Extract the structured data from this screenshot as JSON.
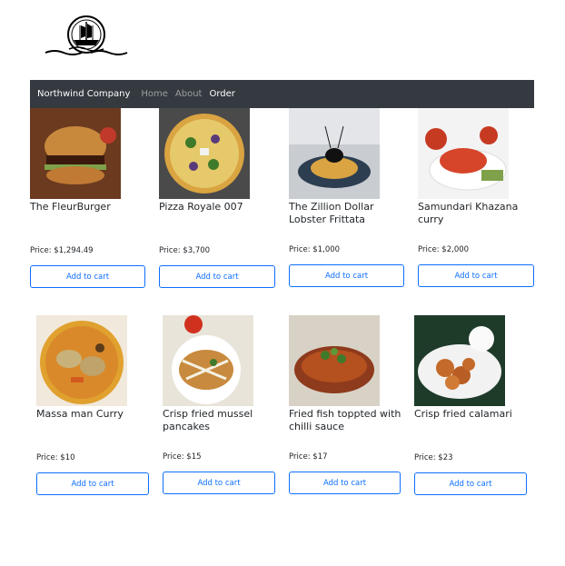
{
  "navbar": {
    "brand": "Northwind Company",
    "links": [
      "Home",
      "About",
      "Order"
    ]
  },
  "products": [
    {
      "name": "The FleurBurger",
      "price": "Price: $1,294.49",
      "button": "Add to cart"
    },
    {
      "name": "Pizza Royale 007",
      "price": "Price: $3,700",
      "button": "Add to cart"
    },
    {
      "name": "The Zillion Dollar Lobster Frittata",
      "price": "Price: $1,000",
      "button": "Add to cart"
    },
    {
      "name": "Samundari Khazana curry",
      "price": "Price: $2,000",
      "button": "Add to cart"
    },
    {
      "name": "Massa man Curry",
      "price": "Price: $10",
      "button": "Add to cart"
    },
    {
      "name": "Crisp fried mussel pancakes",
      "price": "Price: $15",
      "button": "Add to cart"
    },
    {
      "name": "Fried fish toppted with chilli sauce",
      "price": "Price: $17",
      "button": "Add to cart"
    },
    {
      "name": "Crisp fried calamari",
      "price": "Price: $23",
      "button": "Add to cart"
    }
  ],
  "colors": {
    "navbar": "#343a40",
    "accent": "#0d6efd"
  }
}
